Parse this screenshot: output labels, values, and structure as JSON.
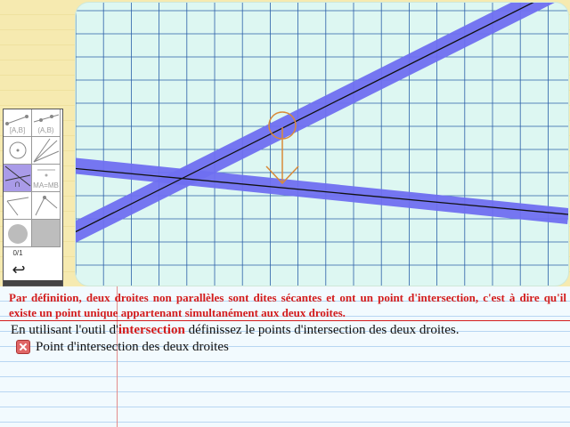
{
  "toolbox": {
    "tools": [
      {
        "name": "segment-tool",
        "label": "[A,B]"
      },
      {
        "name": "ray-tool",
        "label": "(A,B)"
      },
      {
        "name": "point-tool",
        "label": ""
      },
      {
        "name": "lines-tool",
        "label": ""
      },
      {
        "name": "intersection-tool",
        "label": "∩"
      },
      {
        "name": "equidistance-tool",
        "label": "MA=MB"
      },
      {
        "name": "compass-tool",
        "label": ""
      },
      {
        "name": "polygon-tool",
        "label": ""
      },
      {
        "name": "fill-tool",
        "label": ""
      },
      {
        "name": "color-tool",
        "label": ""
      }
    ],
    "counter": "0/1",
    "back_symbol": "↩"
  },
  "definition": "Par définition, deux droites non parallèles sont dites sécantes et ont un point d'intersection, c'est à dire qu'il existe un point unique appartenant simultanément aux deux droites.",
  "instruction": {
    "before": "En utilisant l'outil d'",
    "keyword": "intersection",
    "after": " définissez le points d'intersection des deux droites."
  },
  "task": {
    "label": "Point d'intersection des deux droites",
    "status_icon": "cross-icon"
  },
  "colors": {
    "board": "#ddf7f2",
    "grid": "#2b5fa8",
    "line_highlight": "#6f6ff0",
    "hint": "#d98a3a",
    "definition": "#d31c1c"
  }
}
